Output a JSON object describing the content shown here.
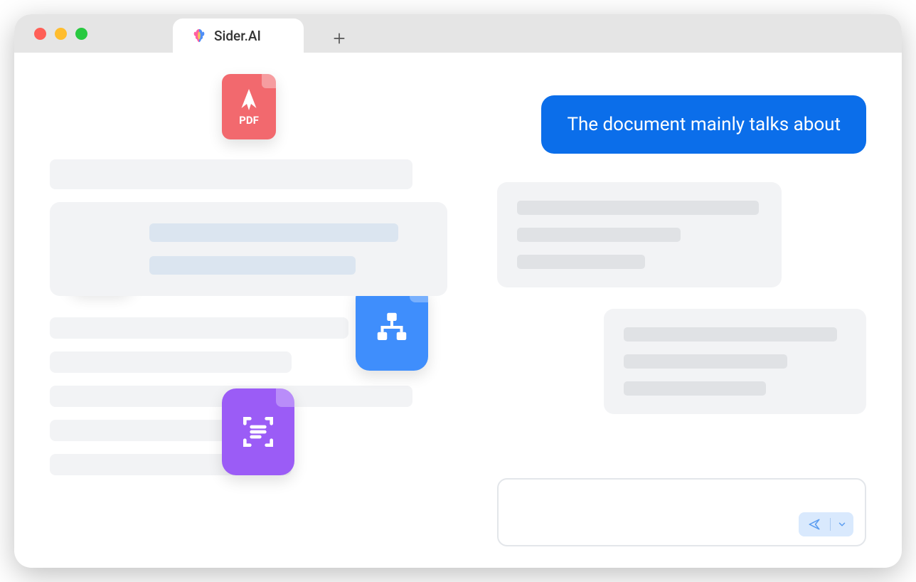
{
  "tab": {
    "title": "Sider.AI"
  },
  "files": {
    "pdf_label": "PDF"
  },
  "chat": {
    "user_message": "The document mainly talks about"
  }
}
